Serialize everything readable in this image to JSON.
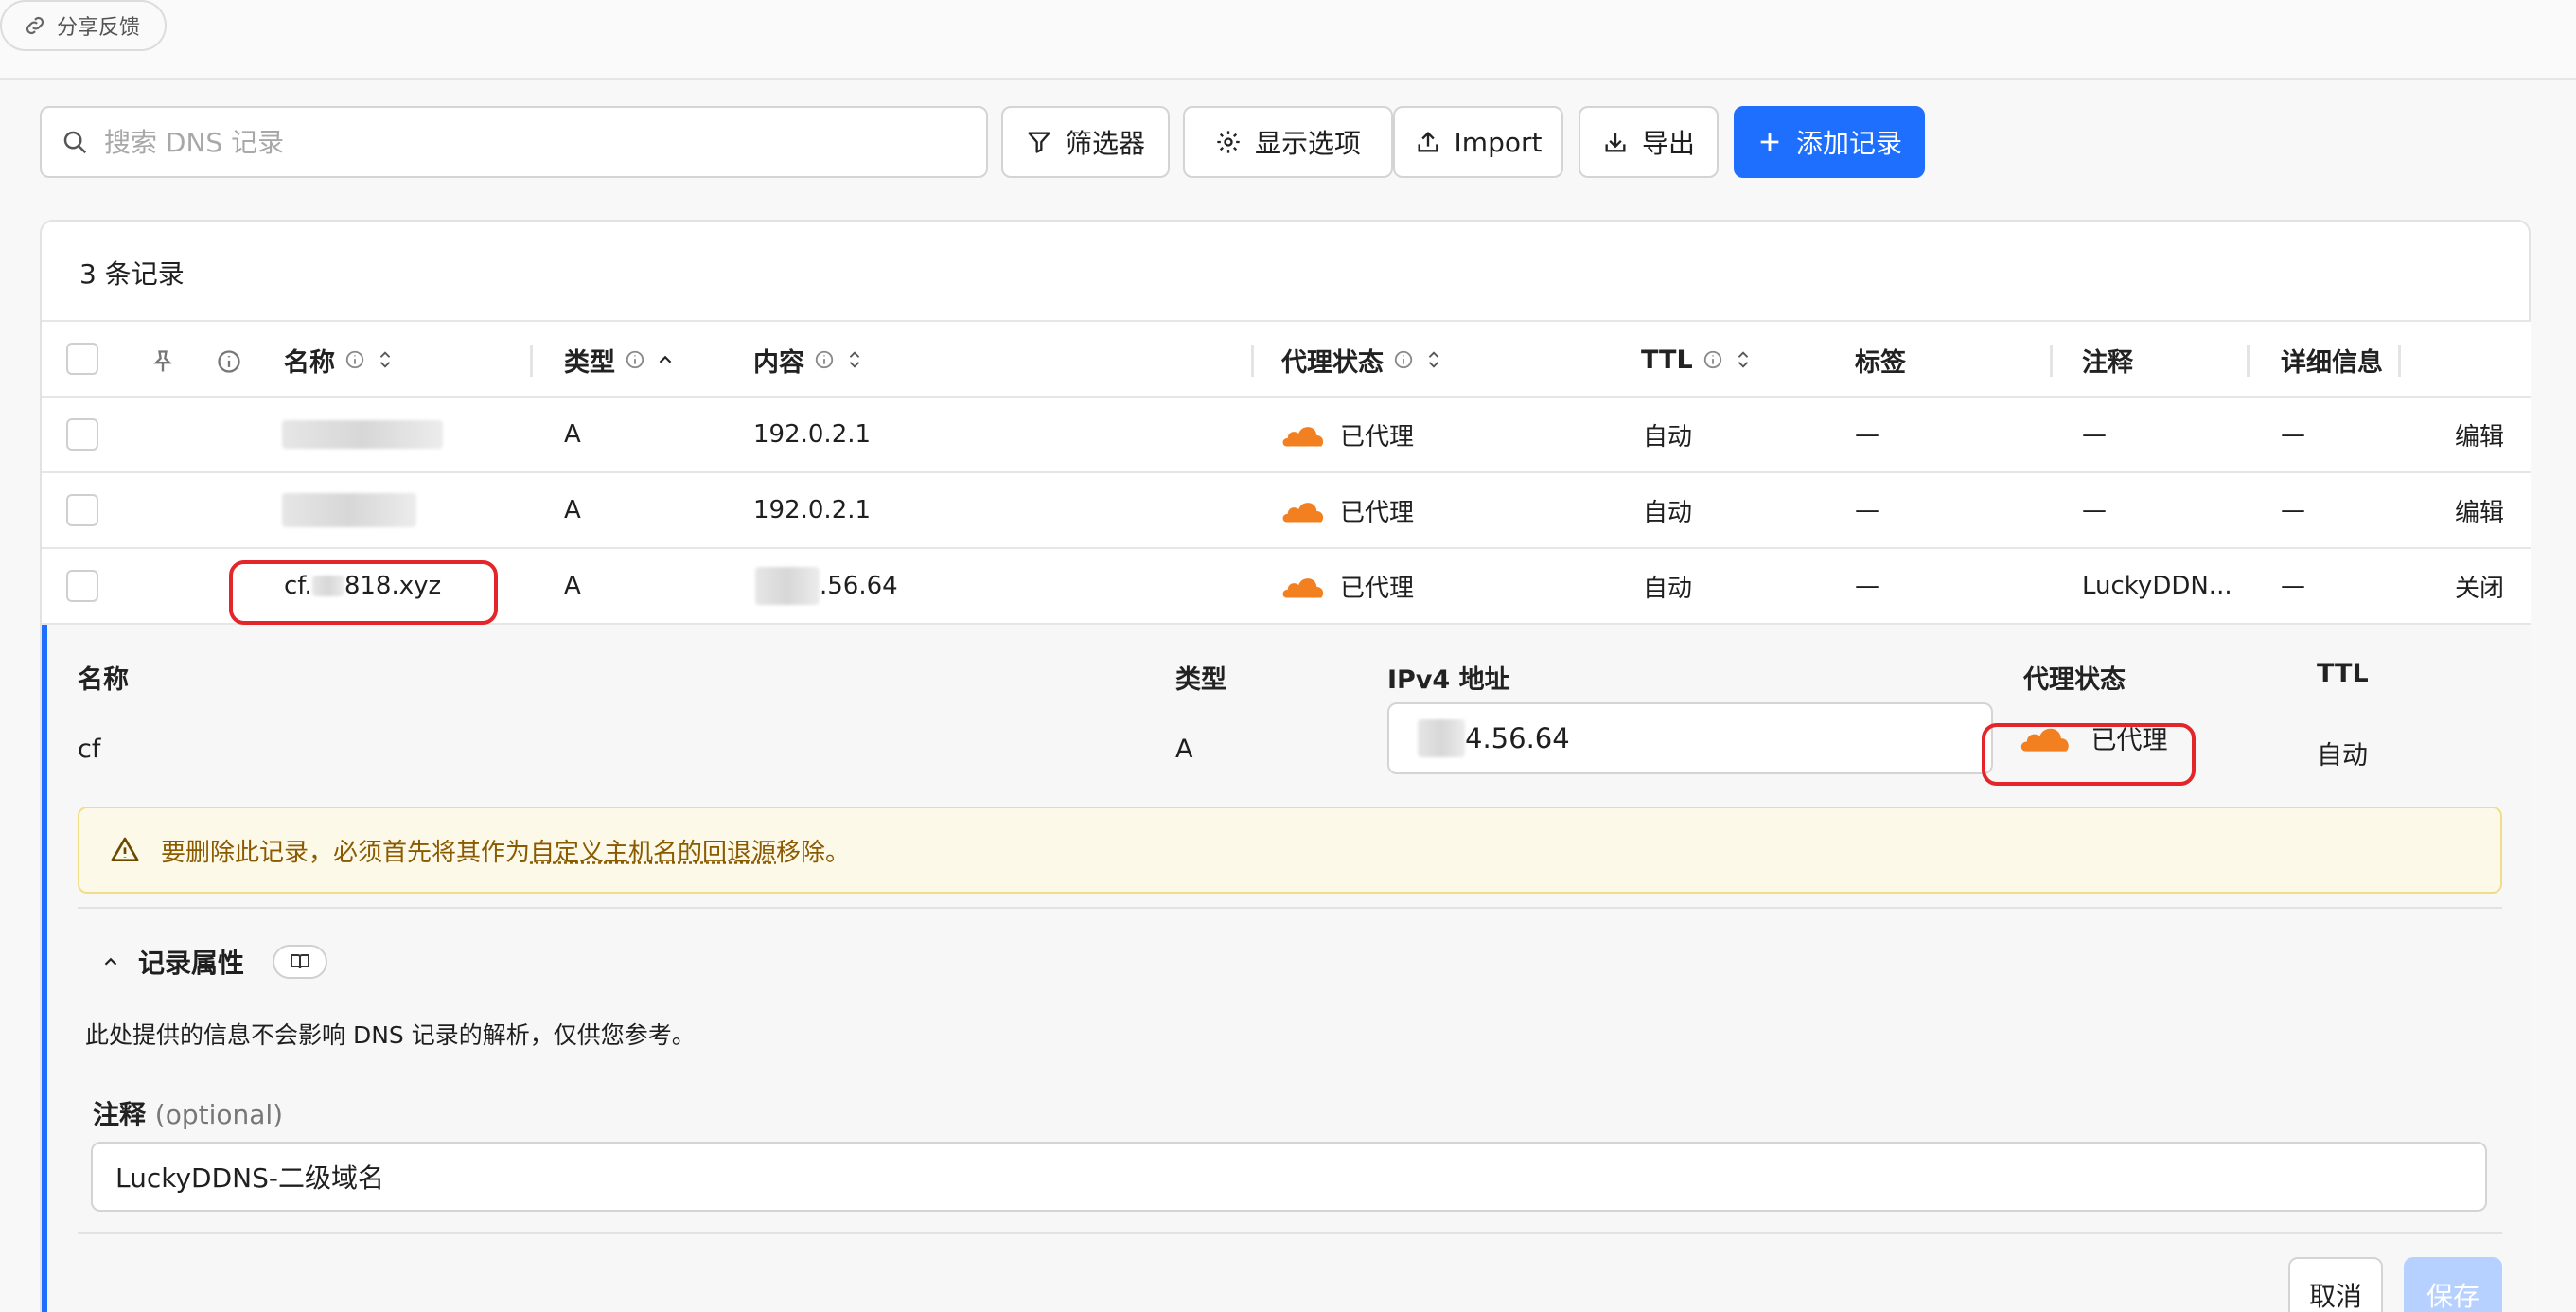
{
  "topbar": {
    "share_label": "分享反馈"
  },
  "toolbar": {
    "search_placeholder": "搜索 DNS 记录",
    "filter_label": "筛选器",
    "display_label": "显示选项",
    "import_label": "Import",
    "export_label": "导出",
    "add_label": "添加记录"
  },
  "records": {
    "count_label": "3 条记录",
    "columns": {
      "name": "名称",
      "type": "类型",
      "content": "内容",
      "proxy": "代理状态",
      "ttl": "TTL",
      "tags": "标签",
      "comment": "注释",
      "details": "详细信息"
    },
    "rows": [
      {
        "name": "",
        "type": "A",
        "content": "192.0.2.1",
        "proxy": "已代理",
        "ttl": "自动",
        "tags": "—",
        "comment": "—",
        "details": "—",
        "action": "编辑"
      },
      {
        "name": "",
        "type": "A",
        "content": "192.0.2.1",
        "proxy": "已代理",
        "ttl": "自动",
        "tags": "—",
        "comment": "—",
        "details": "—",
        "action": "编辑"
      },
      {
        "name": "cf.818.xyz",
        "name_prefix": "cf.",
        "name_suffix": "818.xyz",
        "type": "A",
        "content": ".56.64",
        "proxy": "已代理",
        "ttl": "自动",
        "tags": "—",
        "comment": "LuckyDDN...",
        "details": "—",
        "action": "关闭"
      }
    ]
  },
  "editor": {
    "name_label": "名称",
    "name_value": "cf",
    "type_label": "类型",
    "type_value": "A",
    "ip_label": "IPv4 地址",
    "ip_value": "4.56.64",
    "proxy_label": "代理状态",
    "proxy_value": "已代理",
    "ttl_label": "TTL",
    "ttl_value": "自动",
    "warning_prefix": "要删除此记录，必须首先将其作为",
    "warning_link": "自定义主机名的回退源",
    "warning_suffix": "移除。",
    "section_title": "记录属性",
    "section_desc": "此处提供的信息不会影响 DNS 记录的解析，仅供您参考。",
    "comment_label": "注释",
    "comment_optional": "(optional)",
    "comment_value": "LuckyDDNS-二级域名",
    "cancel_label": "取消",
    "save_label": "保存"
  },
  "colors": {
    "accent": "#1f6fff",
    "cloud": "#f38020",
    "highlight": "#e3262a",
    "warning_bg": "#fdf9e8"
  },
  "icons": [
    "link-icon",
    "search-icon",
    "filter-icon",
    "gear-icon",
    "upload-icon",
    "download-icon",
    "plus-icon",
    "pin-icon",
    "info-icon",
    "sort-icon",
    "cloud-icon",
    "warning-icon",
    "chevron-up-icon",
    "book-icon"
  ]
}
